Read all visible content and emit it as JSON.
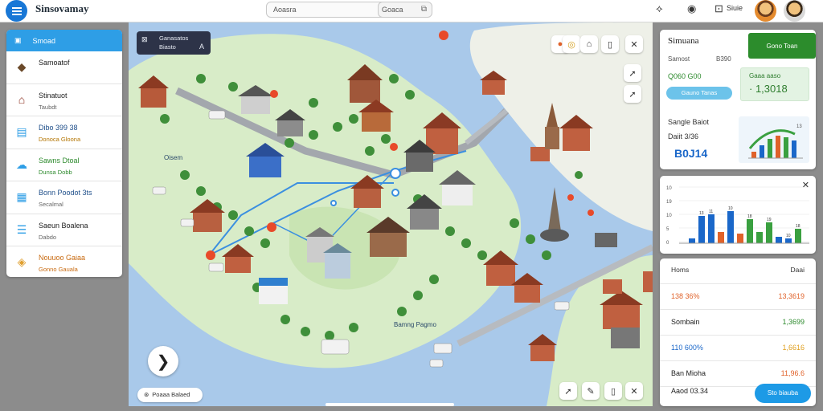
{
  "app": {
    "title": "Sinsovamay"
  },
  "header": {
    "search_placeholder": "Aoasra",
    "search_button_label": "Goaca",
    "label_right": "Siuie",
    "icons": [
      "puzzle-icon",
      "compass-icon",
      "export-icon"
    ]
  },
  "sidebar": {
    "header_label": "Smoad",
    "items": [
      {
        "line1": "Samoatof",
        "line2": "",
        "icon": "box-icon",
        "color": "#6b4a2a"
      },
      {
        "line1": "Stinatuot",
        "line2": "Taubdt",
        "icon": "house-icon",
        "color": "#8a2e1e"
      },
      {
        "line1": "Dibo 399 38",
        "line2": "Donoca Gloona",
        "icon": "document-icon",
        "color": "#2e9ee6",
        "line1_color": "#1f4f8a",
        "line2_color": "#b37400"
      },
      {
        "line1": "Sawns Dtoal",
        "line2": "Dunsa Dobb",
        "icon": "cloud-icon",
        "color": "#2e9ee6",
        "line1_color": "#2e8b2e",
        "line2_color": "#2e8b2e"
      },
      {
        "line1": "Bonn Poodot 3ts",
        "line2": "Secalmal",
        "icon": "clipboard-icon",
        "color": "#2e9ee6",
        "line1_color": "#1f4f8a"
      },
      {
        "line1": "Saeun Boalena",
        "line2": "Dabdo",
        "icon": "list-icon",
        "color": "#2e9ee6"
      },
      {
        "line1": "Nouuoo Gaiaa",
        "line2": "Gonno Gauala",
        "icon": "layers-icon",
        "color": "#e0a030",
        "line1_color": "#c86a10",
        "line2_color": "#c86a10"
      }
    ]
  },
  "map": {
    "card_line1": "Ganasatos",
    "card_line2": "Biasto",
    "card_badge": "A",
    "pill_label": "Poaaa Balaed",
    "place_label_1": "Oisem",
    "place_label_2": "Bamng Pagmo",
    "play_icon": "play-icon",
    "tools_top": [
      "pin-icon",
      "camera-icon",
      "tag-icon",
      "bookmark-icon",
      "close-icon"
    ],
    "tools_side": [
      "navigate-icon",
      "navigate-icon"
    ],
    "tools_bottom": [
      "navigate-icon",
      "pencil-icon",
      "bookmark-icon",
      "close-icon"
    ]
  },
  "panel_summary": {
    "title": "Simuana",
    "green_button": "Gono Toan",
    "sub_label": "Samost",
    "sub_value": "B390",
    "value_green": "Q060 G00",
    "blue_button": "Gauno Tanas",
    "box_label": "Gaaa aaso",
    "box_value": "· 1,3018",
    "section_label": "Sangle Baiot",
    "section_sub": "Daiit 3/36",
    "big_value": "B0J14",
    "mini_chart_icon": "area-chart-icon"
  },
  "panel_bars": {
    "close_icon": "close-icon",
    "ytick_labels": [
      "10",
      "19",
      "10",
      "5",
      "0"
    ],
    "bar_labels": [
      "13",
      "11",
      "10",
      "18",
      "19",
      "10",
      "18"
    ]
  },
  "panel_table": {
    "header_left": "Homs",
    "header_right": "Daai",
    "rows": [
      {
        "k": "138 36%",
        "v": "13,3619",
        "k_color": "#e0622a",
        "v_color": "#e0622a"
      },
      {
        "k": "Sombain",
        "v": "1,3699",
        "k_color": "#222222",
        "v_color": "#2e8b2e"
      },
      {
        "k": "110 600%",
        "v": "1,6616",
        "k_color": "#1a67c9",
        "v_color": "#e0a020"
      },
      {
        "k": "Ban Mioha",
        "v": "11,96.6",
        "k_color": "#222222",
        "v_color": "#e0622a"
      }
    ],
    "footer_label": "Aaod 03.34",
    "footer_button": "Sto biauba"
  },
  "colors": {
    "accent_blue": "#1877d6",
    "sidebar_header": "#2e9ee6",
    "green": "#2c8c2c",
    "water": "#a9c9ea",
    "land": "#d8ecc8"
  }
}
